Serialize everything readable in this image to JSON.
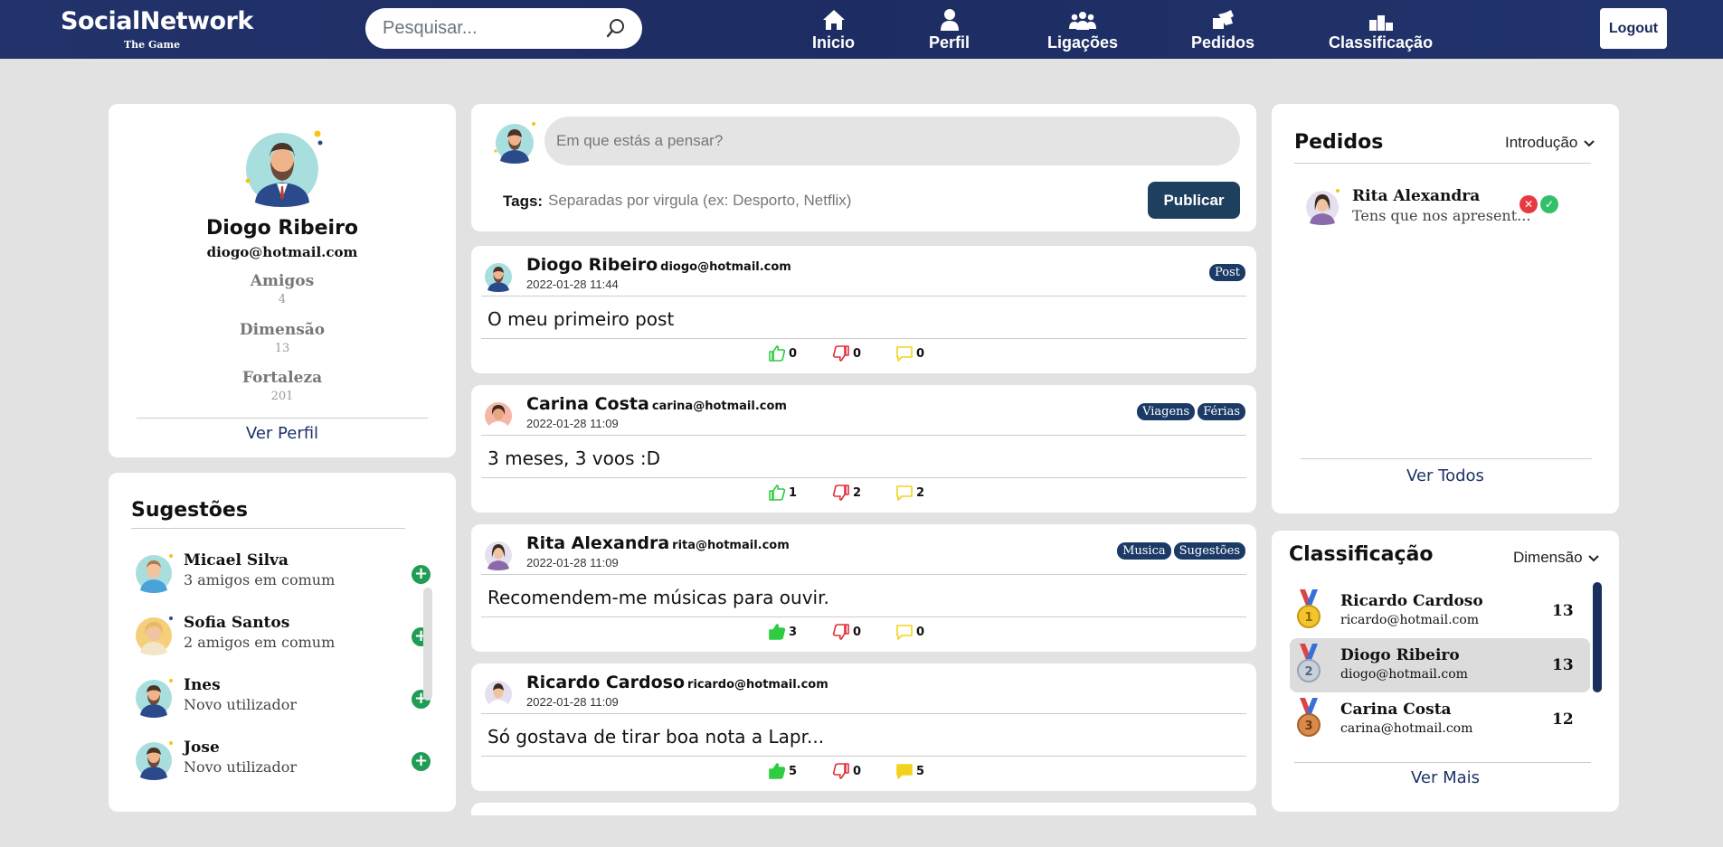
{
  "brand": {
    "title": "SocialNetwork",
    "subtitle": "The Game"
  },
  "search": {
    "placeholder": "Pesquisar..."
  },
  "nav": [
    {
      "label": "Inicio",
      "icon": "home-icon"
    },
    {
      "label": "Perfil",
      "icon": "user-icon"
    },
    {
      "label": "Ligações",
      "icon": "users-icon"
    },
    {
      "label": "Pedidos",
      "icon": "requests-icon"
    },
    {
      "label": "Classificação",
      "icon": "podium-icon"
    }
  ],
  "logout_label": "Logout",
  "profile": {
    "name": "Diogo Ribeiro",
    "email": "diogo@hotmail.com",
    "stats": [
      {
        "label": "Amigos",
        "value": "4"
      },
      {
        "label": "Dimensão",
        "value": "13"
      },
      {
        "label": "Fortaleza",
        "value": "201"
      }
    ],
    "link": "Ver Perfil"
  },
  "suggestions": {
    "title": "Sugestões",
    "items": [
      {
        "name": "Micael Silva",
        "sub": "3 amigos em comum"
      },
      {
        "name": "Sofia Santos",
        "sub": "2 amigos em comum"
      },
      {
        "name": "Ines",
        "sub": "Novo utilizador"
      },
      {
        "name": "Jose",
        "sub": "Novo utilizador"
      }
    ]
  },
  "composer": {
    "placeholder": "Em que estás a pensar?",
    "tags_label": "Tags:",
    "tags_placeholder": "Separadas por virgula (ex: Desporto, Netflix)",
    "publish_label": "Publicar"
  },
  "posts": [
    {
      "author": "Diogo Ribeiro",
      "email": "diogo@hotmail.com",
      "date": "2022-01-28 11:44",
      "tags": [
        "Post"
      ],
      "content": "O meu primeiro post",
      "likes": "0",
      "dislikes": "0",
      "comments": "0"
    },
    {
      "author": "Carina Costa",
      "email": "carina@hotmail.com",
      "date": "2022-01-28 11:09",
      "tags": [
        "Viagens",
        "Férias"
      ],
      "content": "3 meses, 3 voos :D",
      "likes": "1",
      "dislikes": "2",
      "comments": "2"
    },
    {
      "author": "Rita Alexandra",
      "email": "rita@hotmail.com",
      "date": "2022-01-28 11:09",
      "tags": [
        "Musica",
        "Sugestões"
      ],
      "content": "Recomendem-me músicas para ouvir.",
      "likes": "3",
      "dislikes": "0",
      "comments": "0"
    },
    {
      "author": "Ricardo Cardoso",
      "email": "ricardo@hotmail.com",
      "date": "2022-01-28 11:09",
      "tags": [],
      "content": "Só gostava de tirar boa nota a Lapr...",
      "likes": "5",
      "dislikes": "0",
      "comments": "5"
    }
  ],
  "requests": {
    "title": "Pedidos",
    "filter": "Introdução",
    "items": [
      {
        "name": "Rita Alexandra",
        "message": "Tens que nos apresent..."
      }
    ],
    "link": "Ver Todos"
  },
  "ranking": {
    "title": "Classificação",
    "filter": "Dimensão",
    "items": [
      {
        "name": "Ricardo Cardoso",
        "email": "ricardo@hotmail.com",
        "value": "13",
        "medal": "1"
      },
      {
        "name": "Diogo Ribeiro",
        "email": "diogo@hotmail.com",
        "value": "13",
        "medal": "2"
      },
      {
        "name": "Carina Costa",
        "email": "carina@hotmail.com",
        "value": "12",
        "medal": "3"
      }
    ],
    "link": "Ver Mais"
  },
  "colors": {
    "navbar": "#1f2f66",
    "accent": "#1b3268",
    "like_green": "#2ecc40",
    "dislike_red": "#e0303a",
    "comment_yellow": "#f2d21b",
    "add_green": "#1f9d55",
    "publish": "#1e3f5e"
  }
}
